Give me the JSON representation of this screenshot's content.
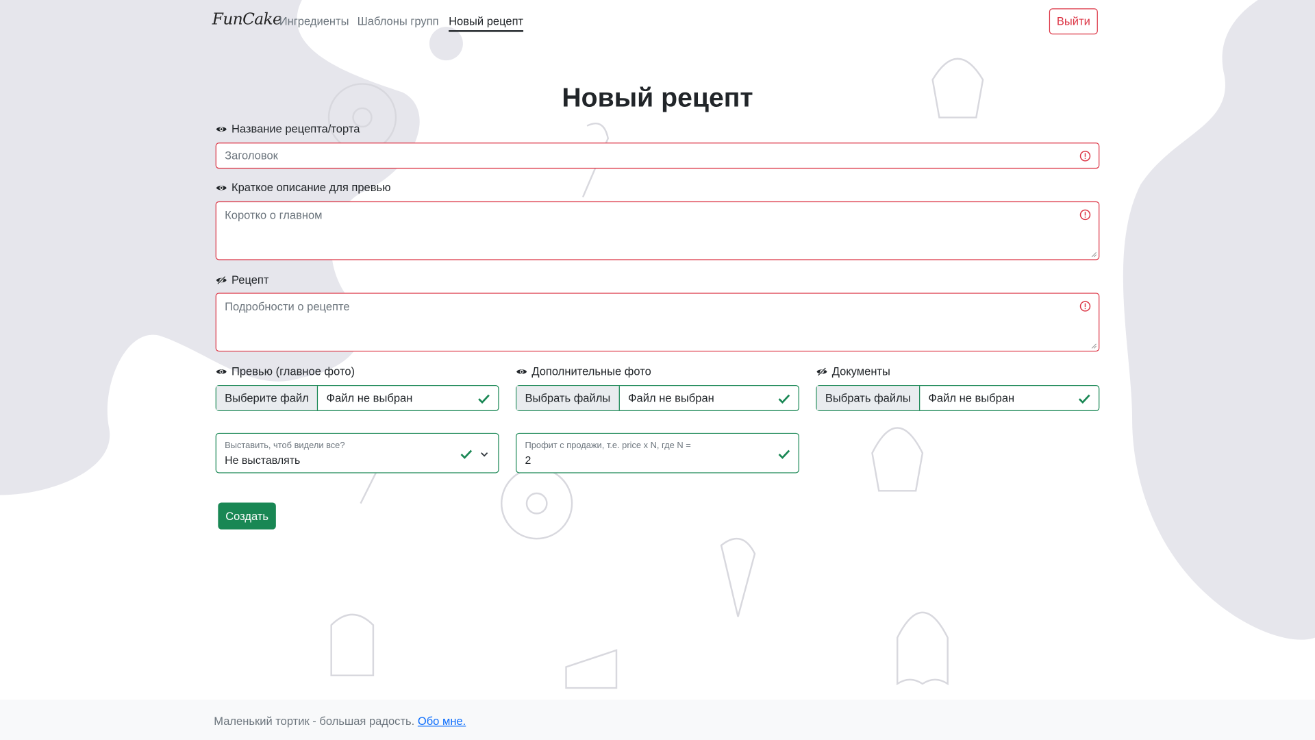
{
  "nav": {
    "logo": "FunCake",
    "links": [
      "Ингредиенты",
      "Шаблоны групп",
      "Новый рецепт"
    ],
    "logout": "Выйти"
  },
  "page_title": "Новый рецепт",
  "form": {
    "title": {
      "label": "Название рецепта/торта",
      "placeholder": "Заголовок"
    },
    "description": {
      "label": "Краткое описание для превью",
      "placeholder": "Коротко о главном"
    },
    "recipe": {
      "label": "Рецепт",
      "placeholder": "Подробности о рецепте"
    },
    "preview_photo": {
      "label": "Превью (главное фото)",
      "button": "Выберите файл",
      "status": "Файл не выбран"
    },
    "extra_photos": {
      "label": "Дополнительные фото",
      "button": "Выбрать файлы",
      "status": "Файл не выбран"
    },
    "documents": {
      "label": "Документы",
      "button": "Выбрать файлы",
      "status": "Файл не выбран"
    },
    "visibility": {
      "label": "Выставить, чтоб видели все?",
      "value": "Не выставлять"
    },
    "profit": {
      "label": "Профит с продажи, т.е. price x N, где N =",
      "value": "2"
    },
    "submit": "Создать"
  },
  "footer": {
    "text": "Маленький тортик - большая радость.",
    "link": "Обо мне."
  },
  "colors": {
    "invalid": "#dc3545",
    "valid": "#198754",
    "submit": "#198754",
    "link": "#0d6efd"
  }
}
